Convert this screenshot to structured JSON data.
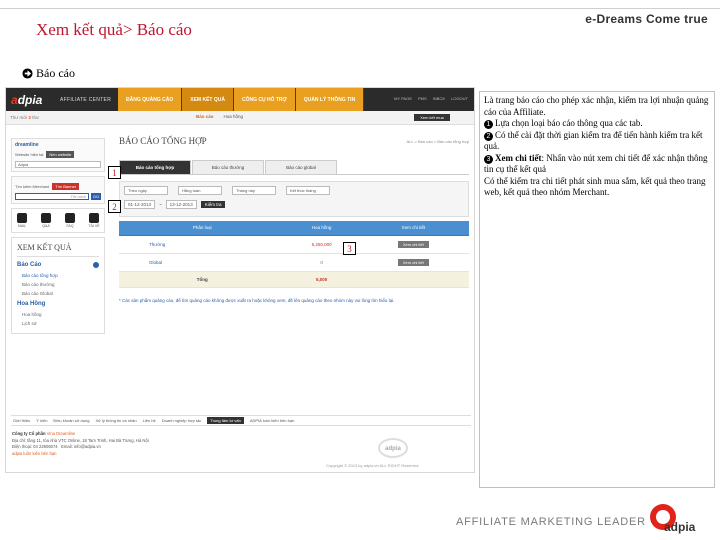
{
  "slide": {
    "title": "Xem kết quả> Báo cáo",
    "brand": "e-Dreams Come true",
    "sub_heading": "Báo cáo"
  },
  "app": {
    "logo_a": "a",
    "logo_rest": "dpia",
    "center_label": "AFFILIATE CENTER",
    "nav": [
      "ĐĂNG QUẢNG CÁO",
      "XEM KẾT QUẢ",
      "CÔNG CỤ HỖ TRỢ",
      "QUẢN LÝ THÔNG TIN"
    ],
    "top_links": [
      "MY PAGE",
      "PMS",
      "INBOX",
      "LOGOUT"
    ],
    "subbar": {
      "crumb_prefix": "Thư mời",
      "crumb_count": "2",
      "crumb_suffix": "thư",
      "tabs": [
        "Báo cáo",
        "Hoa hồng"
      ],
      "dark_button": "Xem kết mua"
    }
  },
  "sidebar": {
    "site_name": "dreamline",
    "website_label": "Website hiện tại",
    "website_btn": "Nền website",
    "site_select": "Adpia",
    "merchant_label": "Tìm kiếm Merchant",
    "merchant_btn": "Tìm Banner",
    "search_placeholder": "Tên web",
    "go": "GO",
    "icons": [
      {
        "name": "mail-icon",
        "label": "MAIL"
      },
      {
        "name": "question-icon",
        "label": "Q&A"
      },
      {
        "name": "faq-icon",
        "label": "FAQ"
      },
      {
        "name": "download-icon",
        "label": "TẢI VỀ"
      }
    ],
    "result_title": "XEM KẾT QUẢ",
    "groups": [
      {
        "title": "Báo Cáo",
        "items": [
          "Báo cáo tổng hợp",
          "Báo cáo thường",
          "Báo cáo Global"
        ]
      },
      {
        "title": "Hoa Hồng",
        "items": [
          "Hoa hồng",
          "Lịch sử"
        ]
      }
    ]
  },
  "main": {
    "title": "BÁO CÁO TỔNG HỢP",
    "breadcrumb": "ALL > Báo cáo > Báo cáo tổng hợp",
    "tabs": [
      "Báo cáo tổng hợp",
      "Báo cáo thường",
      "Báo cáo global"
    ],
    "filters": [
      "Theo ngày",
      "Hằng tuần",
      "Tháng này",
      "Kết thúc tháng"
    ],
    "date_from": "01-12-2013",
    "date_to": "13-12-2013",
    "date_button": "Kiểm tra",
    "table": {
      "headers": [
        "Phân loại",
        "Hoa hồng",
        "Xem chi tiết"
      ],
      "rows": [
        {
          "cat": "Thường",
          "amount": "5,250,000",
          "action": "Xem chi tiết"
        },
        {
          "cat": "Global",
          "amount": "0",
          "action": "Xem chi tiết"
        }
      ],
      "total_label": "Tổng",
      "total_amount": "5,000"
    },
    "note": "* Các sản phẩm quảng cáo, để tìm quảng cáo không được xuất ra hoặc không xem, đề lên quảng cáo theo nhóm này vui lòng tìm hiểu lại. "
  },
  "footer": {
    "links": [
      "Giới thiệu",
      "Ý kiến",
      "Điều khoản sử dụng",
      "Xử lý thông tin cá nhân",
      "Liên hệ",
      "Doanh nghiệp hợp tác"
    ],
    "highlight": "Trung tâm tư vấn",
    "after": "ADPIA luôn kiên bên bạn",
    "company_label": "Công ty Cổ phần",
    "company_name": "Vina Dreamline",
    "address": "Địa chỉ: tầng 11, tòa nhà VTC Online, 18 Tam Trinh, Hai Bà Trưng, Hà Nội",
    "phone": "Điện thoại: 04 22606074",
    "email": "Email: info@adpia.vn",
    "slogan": "adpia luôn kiên bên bạn",
    "logo": "adpia",
    "copyright": "Copyright © 2013 by adpia.vn ALL RIGHT Reserved."
  },
  "markers": [
    "1",
    "2",
    "3"
  ],
  "description": {
    "intro": "Là trang báo cáo cho phép xác nhận, kiểm tra lợi nhuận quảng cáo của Affiliate.",
    "items": [
      {
        "num": "1",
        "text": "Lựa chọn loại báo cáo thông qua các tab."
      },
      {
        "num": "2",
        "text": "Có thể cài đặt thời gian kiểm tra để tiến hành kiểm tra kết quả."
      },
      {
        "num": "3",
        "bold": "Xem chi tiết",
        "text": ": Nhấn vào nút xem chi tiết để xác nhận thông tin cụ thể kết quả"
      }
    ],
    "outro": "Có thể kiểm tra chi tiết phát sinh mua sắm, kết quả theo trang web, kết quả theo nhóm Merchant."
  },
  "bottom": {
    "tagline": "AFFILIATE MARKETING LEADER",
    "logo": "adpia",
    "accent": "#e2231a"
  }
}
